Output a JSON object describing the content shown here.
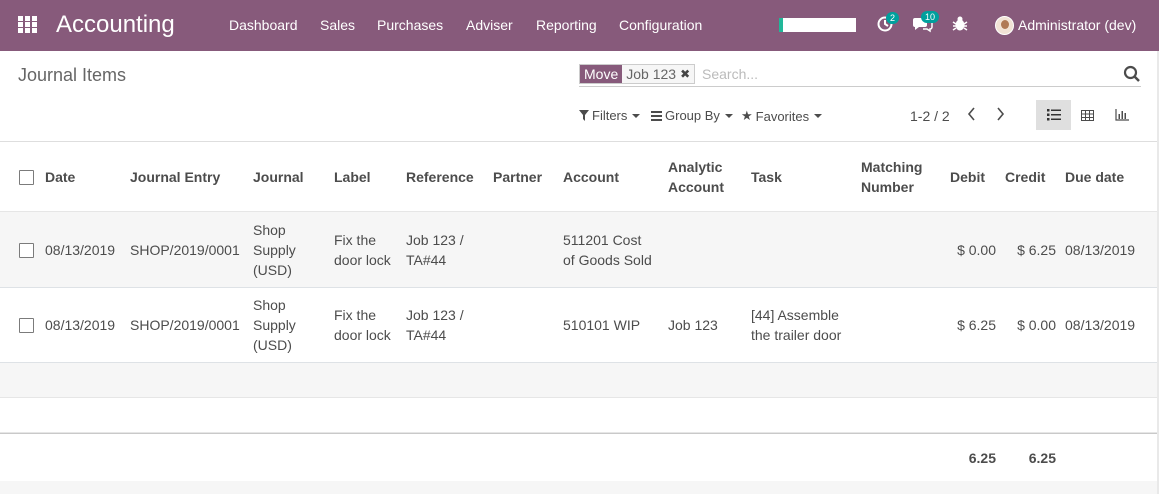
{
  "navbar": {
    "app_name": "Accounting",
    "menu": [
      "Dashboard",
      "Sales",
      "Purchases",
      "Adviser",
      "Reporting",
      "Configuration"
    ],
    "activity_count": "2",
    "messages_count": "10",
    "user_name": "Administrator (dev)",
    "icons": [
      "apps-grid-icon",
      "activity-clock-icon",
      "chat-bubbles-icon",
      "bug-icon",
      "user-avatar"
    ],
    "colors": {
      "brand": "#875a7b",
      "badge": "#00a09d"
    }
  },
  "control_panel": {
    "title": "Journal Items",
    "search": {
      "facet_label": "Move",
      "facet_value": "Job 123",
      "placeholder": "Search..."
    },
    "filters_label": "Filters",
    "groupby_label": "Group By",
    "favorites_label": "Favorites",
    "pager": "1-2 / 2",
    "views": [
      "list-view-icon",
      "pivot-view-icon",
      "graph-view-icon"
    ],
    "active_view": "list"
  },
  "table": {
    "headers": {
      "date": "Date",
      "journal_entry": "Journal Entry",
      "journal": "Journal",
      "label": "Label",
      "reference": "Reference",
      "partner": "Partner",
      "account": "Account",
      "analytic_line1": "Analytic",
      "analytic_line2": "Account",
      "task": "Task",
      "matching_line1": "Matching",
      "matching_line2": "Number",
      "debit": "Debit",
      "credit": "Credit",
      "due_date": "Due date"
    },
    "rows": [
      {
        "date": "08/13/2019",
        "journal_entry": "SHOP/2019/0001",
        "journal": [
          "Shop",
          "Supply",
          "(USD)"
        ],
        "label": [
          "Fix the",
          "door lock"
        ],
        "reference": [
          "Job 123 /",
          "TA#44"
        ],
        "partner": "",
        "account": [
          "511201 Cost",
          "of Goods Sold"
        ],
        "analytic": "",
        "task": [
          "",
          ""
        ],
        "matching": "",
        "debit": "$ 0.00",
        "credit": "$ 6.25",
        "due_date": "08/13/2019"
      },
      {
        "date": "08/13/2019",
        "journal_entry": "SHOP/2019/0001",
        "journal": [
          "Shop",
          "Supply",
          "(USD)"
        ],
        "label": [
          "Fix the",
          "door lock"
        ],
        "reference": [
          "Job 123 /",
          "TA#44"
        ],
        "partner": "",
        "account": [
          "510101 WIP",
          ""
        ],
        "analytic": "Job 123",
        "task": [
          "[44] Assemble",
          "the trailer door"
        ],
        "matching": "",
        "debit": "$ 6.25",
        "credit": "$ 0.00",
        "due_date": "08/13/2019"
      }
    ],
    "totals": {
      "debit": "6.25",
      "credit": "6.25"
    }
  }
}
